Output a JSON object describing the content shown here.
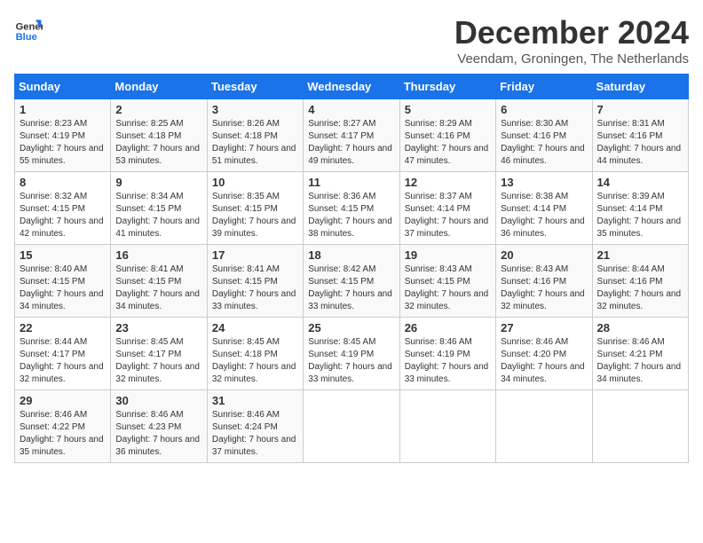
{
  "logo": {
    "line1": "General",
    "line2": "Blue"
  },
  "title": "December 2024",
  "subtitle": "Veendam, Groningen, The Netherlands",
  "days_of_week": [
    "Sunday",
    "Monday",
    "Tuesday",
    "Wednesday",
    "Thursday",
    "Friday",
    "Saturday"
  ],
  "weeks": [
    [
      {
        "day": "1",
        "sunrise": "8:23 AM",
        "sunset": "4:19 PM",
        "daylight": "7 hours and 55 minutes."
      },
      {
        "day": "2",
        "sunrise": "8:25 AM",
        "sunset": "4:18 PM",
        "daylight": "7 hours and 53 minutes."
      },
      {
        "day": "3",
        "sunrise": "8:26 AM",
        "sunset": "4:18 PM",
        "daylight": "7 hours and 51 minutes."
      },
      {
        "day": "4",
        "sunrise": "8:27 AM",
        "sunset": "4:17 PM",
        "daylight": "7 hours and 49 minutes."
      },
      {
        "day": "5",
        "sunrise": "8:29 AM",
        "sunset": "4:16 PM",
        "daylight": "7 hours and 47 minutes."
      },
      {
        "day": "6",
        "sunrise": "8:30 AM",
        "sunset": "4:16 PM",
        "daylight": "7 hours and 46 minutes."
      },
      {
        "day": "7",
        "sunrise": "8:31 AM",
        "sunset": "4:16 PM",
        "daylight": "7 hours and 44 minutes."
      }
    ],
    [
      {
        "day": "8",
        "sunrise": "8:32 AM",
        "sunset": "4:15 PM",
        "daylight": "7 hours and 42 minutes."
      },
      {
        "day": "9",
        "sunrise": "8:34 AM",
        "sunset": "4:15 PM",
        "daylight": "7 hours and 41 minutes."
      },
      {
        "day": "10",
        "sunrise": "8:35 AM",
        "sunset": "4:15 PM",
        "daylight": "7 hours and 39 minutes."
      },
      {
        "day": "11",
        "sunrise": "8:36 AM",
        "sunset": "4:15 PM",
        "daylight": "7 hours and 38 minutes."
      },
      {
        "day": "12",
        "sunrise": "8:37 AM",
        "sunset": "4:14 PM",
        "daylight": "7 hours and 37 minutes."
      },
      {
        "day": "13",
        "sunrise": "8:38 AM",
        "sunset": "4:14 PM",
        "daylight": "7 hours and 36 minutes."
      },
      {
        "day": "14",
        "sunrise": "8:39 AM",
        "sunset": "4:14 PM",
        "daylight": "7 hours and 35 minutes."
      }
    ],
    [
      {
        "day": "15",
        "sunrise": "8:40 AM",
        "sunset": "4:15 PM",
        "daylight": "7 hours and 34 minutes."
      },
      {
        "day": "16",
        "sunrise": "8:41 AM",
        "sunset": "4:15 PM",
        "daylight": "7 hours and 34 minutes."
      },
      {
        "day": "17",
        "sunrise": "8:41 AM",
        "sunset": "4:15 PM",
        "daylight": "7 hours and 33 minutes."
      },
      {
        "day": "18",
        "sunrise": "8:42 AM",
        "sunset": "4:15 PM",
        "daylight": "7 hours and 33 minutes."
      },
      {
        "day": "19",
        "sunrise": "8:43 AM",
        "sunset": "4:15 PM",
        "daylight": "7 hours and 32 minutes."
      },
      {
        "day": "20",
        "sunrise": "8:43 AM",
        "sunset": "4:16 PM",
        "daylight": "7 hours and 32 minutes."
      },
      {
        "day": "21",
        "sunrise": "8:44 AM",
        "sunset": "4:16 PM",
        "daylight": "7 hours and 32 minutes."
      }
    ],
    [
      {
        "day": "22",
        "sunrise": "8:44 AM",
        "sunset": "4:17 PM",
        "daylight": "7 hours and 32 minutes."
      },
      {
        "day": "23",
        "sunrise": "8:45 AM",
        "sunset": "4:17 PM",
        "daylight": "7 hours and 32 minutes."
      },
      {
        "day": "24",
        "sunrise": "8:45 AM",
        "sunset": "4:18 PM",
        "daylight": "7 hours and 32 minutes."
      },
      {
        "day": "25",
        "sunrise": "8:45 AM",
        "sunset": "4:19 PM",
        "daylight": "7 hours and 33 minutes."
      },
      {
        "day": "26",
        "sunrise": "8:46 AM",
        "sunset": "4:19 PM",
        "daylight": "7 hours and 33 minutes."
      },
      {
        "day": "27",
        "sunrise": "8:46 AM",
        "sunset": "4:20 PM",
        "daylight": "7 hours and 34 minutes."
      },
      {
        "day": "28",
        "sunrise": "8:46 AM",
        "sunset": "4:21 PM",
        "daylight": "7 hours and 34 minutes."
      }
    ],
    [
      {
        "day": "29",
        "sunrise": "8:46 AM",
        "sunset": "4:22 PM",
        "daylight": "7 hours and 35 minutes."
      },
      {
        "day": "30",
        "sunrise": "8:46 AM",
        "sunset": "4:23 PM",
        "daylight": "7 hours and 36 minutes."
      },
      {
        "day": "31",
        "sunrise": "8:46 AM",
        "sunset": "4:24 PM",
        "daylight": "7 hours and 37 minutes."
      },
      null,
      null,
      null,
      null
    ]
  ]
}
